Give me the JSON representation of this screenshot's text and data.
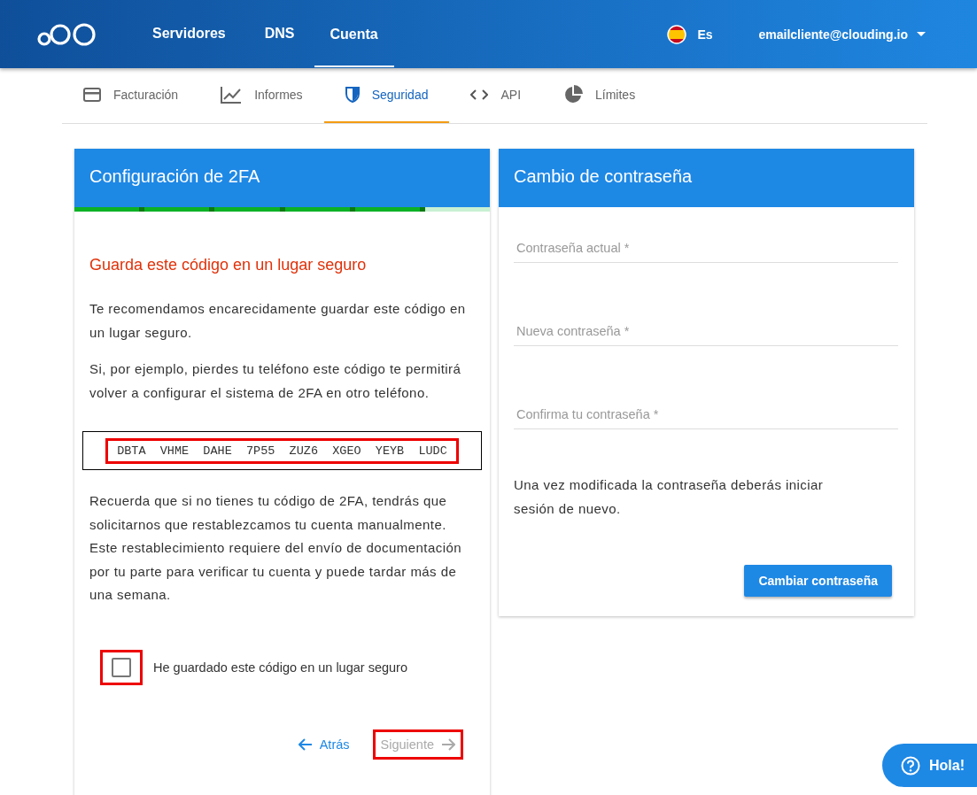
{
  "header": {
    "nav": [
      {
        "label": "Servidores",
        "selected": false
      },
      {
        "label": "DNS",
        "selected": false
      },
      {
        "label": "Cuenta",
        "selected": true
      }
    ],
    "language": "Es",
    "user_email": "emailcliente@clouding.io"
  },
  "tabs": [
    {
      "label": "Facturación",
      "selected": false
    },
    {
      "label": "Informes",
      "selected": false
    },
    {
      "label": "Seguridad",
      "selected": true
    },
    {
      "label": "API",
      "selected": false
    },
    {
      "label": "Límites",
      "selected": false
    }
  ],
  "tfa_card": {
    "title": "Configuración de 2FA",
    "steps": [
      {
        "done": true
      },
      {
        "done": true
      },
      {
        "done": true
      },
      {
        "done": true
      },
      {
        "done": true
      },
      {
        "done": false
      }
    ],
    "heading": "Guarda este código en un lugar seguro",
    "paragraphs": [
      "Te recomendamos encarecidamente guardar este código en un lugar seguro.",
      "Si, por ejemplo, pierdes tu teléfono este código te permitirá volver a configurar el sistema de 2FA en otro teléfono."
    ],
    "code": {
      "text": "DBTA VHME DAHE 7P55 ZUZ6 XGEO YEYB LUDC",
      "highlighted": true
    },
    "warning": "Recuerda que si no tienes tu código de 2FA, tendrás que solicitarnos que restablezcamos tu cuenta manualmente. Este restablecimiento requiere del envío de documentación por tu parte para verificar tu cuenta y puede tardar más de una semana.",
    "confirm": {
      "label": "He guardado este código en un lugar seguro",
      "checked": false,
      "highlighted": true
    },
    "back_button": "Atrás",
    "next_button": {
      "label": "Siguiente",
      "disabled": true,
      "highlighted": true
    }
  },
  "password_card": {
    "title": "Cambio de contraseña",
    "fields": [
      {
        "placeholder": "Contraseña actual *"
      },
      {
        "placeholder": "Nueva contraseña *"
      },
      {
        "placeholder": "Confirma tu contraseña *"
      }
    ],
    "note": "Una vez modificada la contraseña deberás iniciar sesión de nuevo.",
    "submit_button": "Cambiar contraseña"
  },
  "help_button": "Hola!"
}
